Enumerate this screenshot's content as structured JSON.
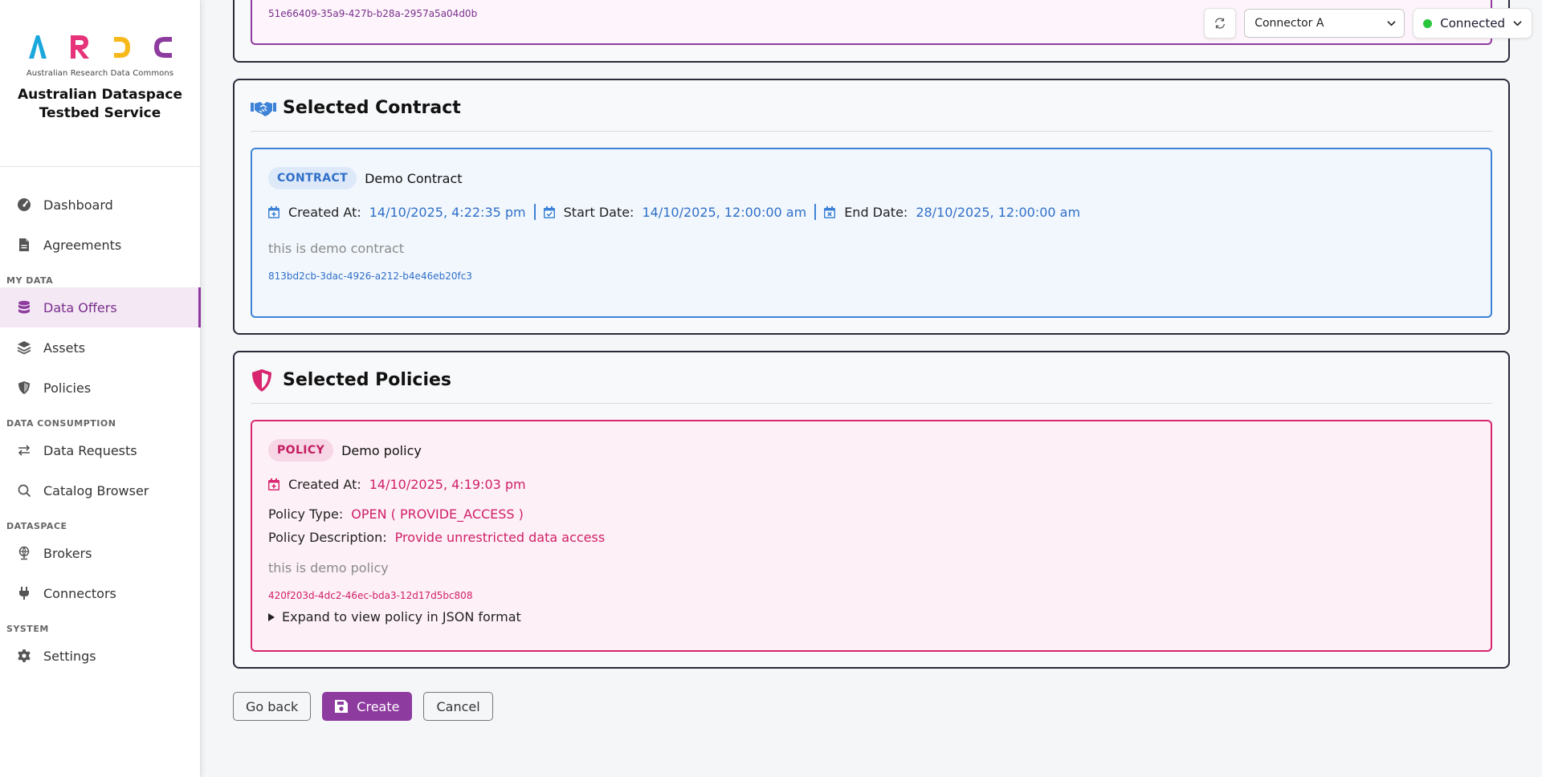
{
  "brand": {
    "logo_letters": [
      "A",
      "R",
      "D",
      "C"
    ],
    "subtitle": "Australian Research Data Commons",
    "title_line1": "Australian Dataspace",
    "title_line2": "Testbed Service",
    "colors": {
      "a": "#1aa7dc",
      "r": "#e6337a",
      "d": "#f5b91b",
      "c": "#8e3ba0"
    }
  },
  "sidebar": {
    "items": [
      {
        "label": "Dashboard",
        "icon": "gauge-icon"
      },
      {
        "label": "Agreements",
        "icon": "document-icon"
      }
    ],
    "sections": [
      {
        "title": "MY DATA",
        "items": [
          {
            "label": "Data Offers",
            "icon": "database-icon",
            "active": true
          },
          {
            "label": "Assets",
            "icon": "layers-icon"
          },
          {
            "label": "Policies",
            "icon": "shield-icon"
          }
        ]
      },
      {
        "title": "DATA CONSUMPTION",
        "items": [
          {
            "label": "Data Requests",
            "icon": "arrows-swap-icon"
          },
          {
            "label": "Catalog Browser",
            "icon": "search-icon"
          }
        ]
      },
      {
        "title": "DATASPACE",
        "items": [
          {
            "label": "Brokers",
            "icon": "globe-icon"
          },
          {
            "label": "Connectors",
            "icon": "plug-icon"
          }
        ]
      },
      {
        "title": "SYSTEM",
        "items": [
          {
            "label": "Settings",
            "icon": "gear-icon"
          }
        ]
      }
    ]
  },
  "topbar": {
    "connector_selected": "Connector A",
    "status": "Connected",
    "status_color": "#29c53c"
  },
  "top_card": {
    "uuid": "51e66409-35a9-427b-b28a-2957a5a04d0b"
  },
  "contract_card": {
    "heading": "Selected Contract",
    "tag": "CONTRACT",
    "name": "Demo Contract",
    "created_label": "Created At:",
    "created_value": "14/10/2025, 4:22:35 pm",
    "start_label": "Start Date:",
    "start_value": "14/10/2025, 12:00:00 am",
    "end_label": "End Date:",
    "end_value": "28/10/2025, 12:00:00 am",
    "description": "this is demo contract",
    "uuid": "813bd2cb-3dac-4926-a212-b4e46eb20fc3"
  },
  "policy_card": {
    "heading": "Selected Policies",
    "tag": "POLICY",
    "name": "Demo policy",
    "created_label": "Created At:",
    "created_value": "14/10/2025, 4:19:03 pm",
    "type_label": "Policy Type:",
    "type_value": "OPEN ( PROVIDE_ACCESS )",
    "desc_label": "Policy Description:",
    "desc_value": "Provide unrestricted data access",
    "description": "this is demo policy",
    "uuid": "420f203d-4dc2-46ec-bda3-12d17d5bc808",
    "expand_label": "Expand to view policy in JSON format"
  },
  "actions": {
    "back": "Go back",
    "create": "Create",
    "cancel": "Cancel"
  }
}
